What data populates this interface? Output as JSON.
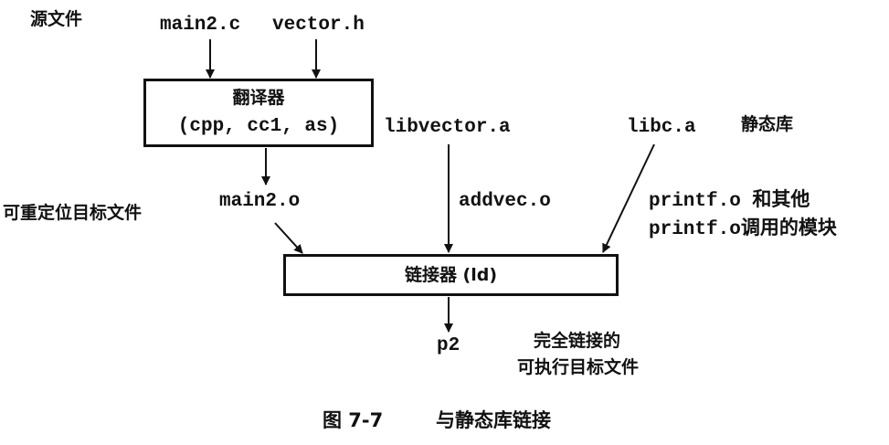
{
  "labels": {
    "source_files": "源文件",
    "main2_c": "main2.c",
    "vector_h": "vector.h",
    "relocatable_objects": "可重定位目标文件",
    "main2_o": "main2.o",
    "libvector_a": "libvector.a",
    "libc_a": "libc.a",
    "static_libraries": "静态库",
    "addvec_o": "addvec.o",
    "printf_line1": "printf.o 和其他",
    "printf_line2": "printf.o调用的模块",
    "p2": "p2",
    "executable_line1": "完全链接的",
    "executable_line2": "可执行目标文件"
  },
  "translator_box": {
    "title": "翻译器",
    "subtitle": "(cpp, cc1, as)"
  },
  "linker_box": {
    "title": "链接器 (ld)"
  },
  "caption": {
    "number": "图 7-7",
    "text": "与静态库链接"
  }
}
